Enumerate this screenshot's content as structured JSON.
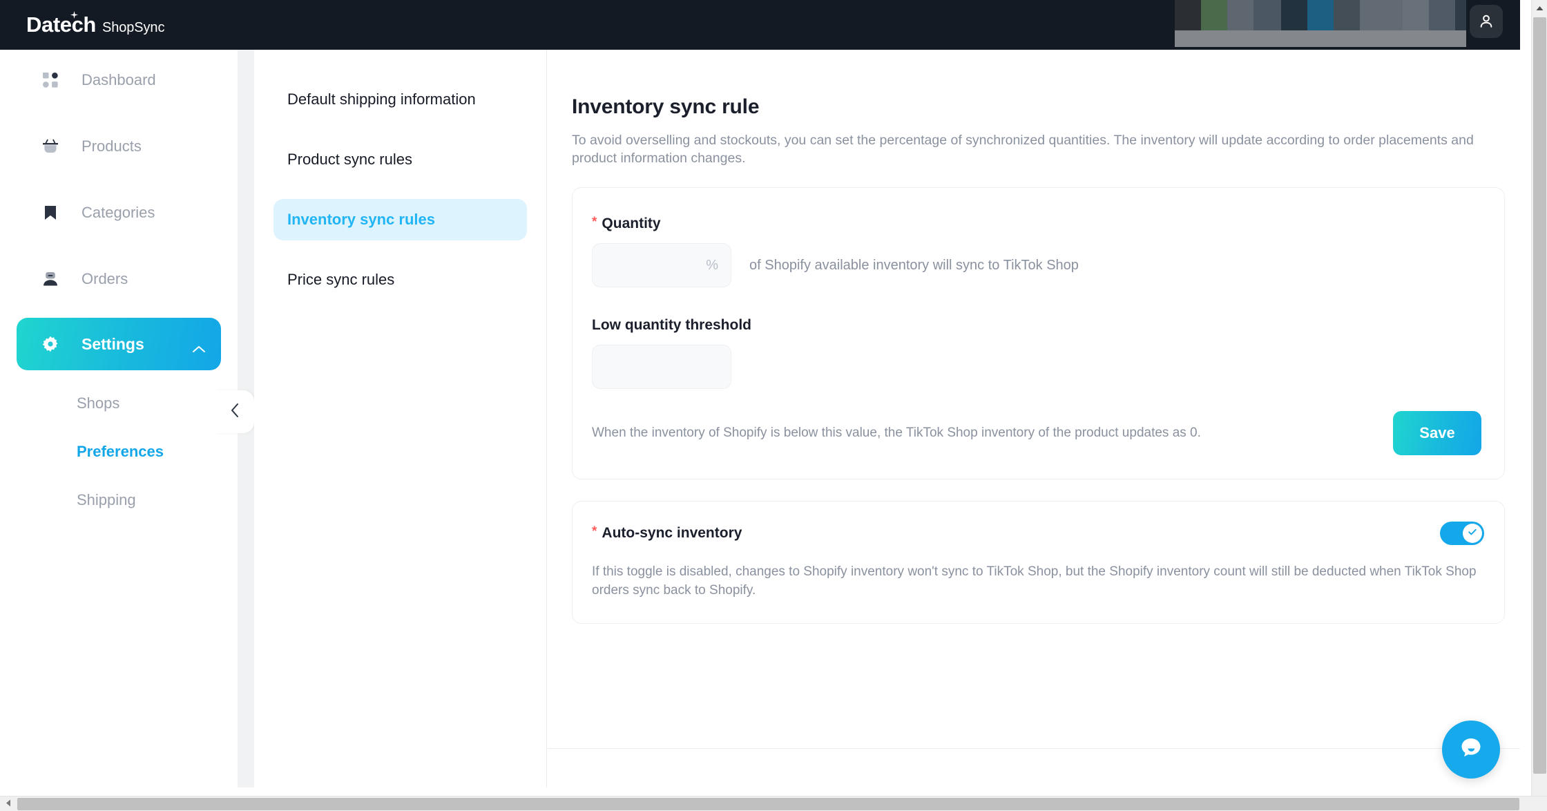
{
  "brand": {
    "name_bold": "Datech",
    "name_light": "ShopSync",
    "accent_gradient_start": "#20d5cf",
    "accent_gradient_end": "#13a6e8",
    "accent": "#13a6e8",
    "required_marker_color": "#ff5b5b",
    "topbar_bg": "#131a23"
  },
  "topbar": {
    "avatar_icon": "user-icon",
    "redacted_blocks": [
      "#2b2f33",
      "#4a6b4b",
      "#5e6670",
      "#4b5762",
      "#23323f",
      "#1d5f82",
      "#444e57",
      "#626a74",
      "#68707a",
      "#4f5a66",
      "#2f3b46"
    ]
  },
  "sidebar": {
    "items": [
      {
        "label": "Dashboard",
        "icon": "grid-dots-icon",
        "active": false
      },
      {
        "label": "Products",
        "icon": "basket-icon",
        "active": false
      },
      {
        "label": "Categories",
        "icon": "bookmark-icon",
        "active": false
      },
      {
        "label": "Orders",
        "icon": "package-icon",
        "active": false
      },
      {
        "label": "Settings",
        "icon": "gear-icon",
        "active": true,
        "expand_icon": "chevron-up-icon"
      }
    ],
    "sub_items": [
      {
        "label": "Shops",
        "active": false
      },
      {
        "label": "Preferences",
        "active": true
      },
      {
        "label": "Shipping",
        "active": false
      }
    ],
    "collapse_icon": "chevron-left-icon"
  },
  "settings_nav": {
    "items": [
      {
        "label": "Default shipping information",
        "active": false
      },
      {
        "label": "Product sync rules",
        "active": false
      },
      {
        "label": "Inventory sync rules",
        "active": true
      },
      {
        "label": "Price sync rules",
        "active": false
      }
    ]
  },
  "main": {
    "title": "Inventory sync rule",
    "description": "To avoid overselling and stockouts, you can set the percentage of synchronized quantities. The inventory will update according to order placements and product information changes.",
    "quantity": {
      "label": "Quantity",
      "required": true,
      "value": "",
      "placeholder": "",
      "suffix": "%",
      "trailing_text": "of Shopify available inventory will sync to TikTok Shop"
    },
    "low_threshold": {
      "label": "Low quantity threshold",
      "required": false,
      "value": "",
      "placeholder": "",
      "helper": "When the inventory of Shopify is below this value, the TikTok Shop inventory of the product updates as 0."
    },
    "save_label": "Save",
    "auto_sync": {
      "label": "Auto-sync inventory",
      "required": true,
      "enabled": true,
      "toggle_icon": "check-icon",
      "description": "If this toggle is disabled, changes to Shopify inventory won't sync to TikTok Shop, but the Shopify inventory count will still be deducted when TikTok Shop orders sync back to Shopify."
    }
  },
  "chat_widget": {
    "icon": "chat-bubble-icon"
  },
  "scrollbars": {
    "vertical_up_icon": "triangle-up-icon",
    "horizontal_left_icon": "triangle-left-icon"
  }
}
